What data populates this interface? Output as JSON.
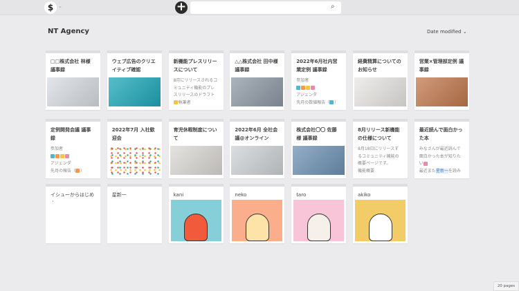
{
  "header": {
    "logo_icon": "project-logo-icon",
    "search_placeholder": "",
    "add_icon": "plus-circle-icon",
    "search_icon": "magnifier-icon"
  },
  "project": {
    "title": "NT Agency",
    "sort_label": "Date modified",
    "sort_icon": "chevron-down-icon"
  },
  "cards": [
    {
      "title": "□□株式会社 林様 議事録",
      "image": "laptop-video-call",
      "img_color": "#d9dde3"
    },
    {
      "title": "ウェブ広告のクリエイティブ確認",
      "image": "web-ad-banner",
      "img_color": "#1fa8b9"
    },
    {
      "title": "新機能プレスリリースについて",
      "desc": [
        {
          "text": "8月にリリースされるコミュニティ機能のプレスリリースのドラフト"
        },
        {
          "text": "執筆者",
          "icons": [
            "#f4c542"
          ]
        }
      ]
    },
    {
      "title": "△△株式会社 田中様 議事録",
      "image": "team-meeting",
      "img_color": "#8f9aa6"
    },
    {
      "title": "2022年6月社内営業定例 議事録",
      "desc": [
        {
          "text": "参加者"
        },
        {
          "text": "",
          "icons": [
            "#4fb7d6",
            "#f19a4b",
            "#f4c542",
            "#e88ca9"
          ]
        },
        {
          "text": "アジェンダ"
        },
        {
          "text": "先月の数値報告（",
          "icons_after": [
            "#4fb7d6"
          ],
          "suffix": "）"
        }
      ]
    },
    {
      "title": "経費精算についてのお知らせ",
      "image": "office-desk",
      "img_color": "#e9e7e4"
    },
    {
      "title": "営業×管理部定例 議事録",
      "image": "hands-together",
      "img_color": "#c27a4e"
    },
    {
      "title": "定例開発会議 議事録",
      "desc": [
        {
          "text": "参加者"
        },
        {
          "text": "",
          "icons": [
            "#4fb7d6",
            "#f19a4b",
            "#f4c542",
            "#e88ca9"
          ]
        },
        {
          "text": "アジェンダ"
        },
        {
          "text": "先月の報告（",
          "icons_after": [
            "#f19a4b"
          ],
          "suffix": "）"
        }
      ]
    },
    {
      "title": "2022年7月 入社歓迎会",
      "image": "confetti",
      "img_color": "#ffffff"
    },
    {
      "title": "育児休暇制度について",
      "image": "baby-with-bear",
      "img_color": "#dcd9d5"
    },
    {
      "title": "2022年6月 全社会議@オンライン",
      "image": "online-meeting",
      "img_color": "#cfd3d6"
    },
    {
      "title": "株式会社〇〇 佐藤様 議事録",
      "image": "workshop-table",
      "img_color": "#6f93b5"
    },
    {
      "title": "8月リリース新機能の仕様について",
      "desc": [
        {
          "text": "8月18日にリリースするコミュニティ機能の概要ページです。"
        },
        {
          "text": "機能概要"
        }
      ]
    },
    {
      "title": "最近読んで面白かった本",
      "desc": [
        {
          "text": "みなさんが最近読んで面白かった本が知りたい",
          "icons_after": [
            "#e88ca9"
          ]
        },
        {
          "text": "最近また",
          "link": "星新一",
          "suffix": "を読み"
        }
      ]
    },
    {
      "title": "イシューからはじめよ",
      "plain": true
    },
    {
      "title": "星新一",
      "plain": true
    },
    {
      "title": "kani",
      "plain": true,
      "image": "crab-illustration",
      "img_color": "#86cfd8",
      "big": true
    },
    {
      "title": "neko",
      "plain": true,
      "image": "cat-illustration",
      "img_color": "#fbae8c",
      "big": true
    },
    {
      "title": "taro",
      "plain": true,
      "image": "man-illustration",
      "img_color": "#f8c4d7",
      "big": true
    },
    {
      "title": "akiko",
      "plain": true,
      "image": "woman-illustration",
      "img_color": "#f2cc66",
      "big": true
    }
  ],
  "footer": {
    "page_count": "20 pages"
  }
}
